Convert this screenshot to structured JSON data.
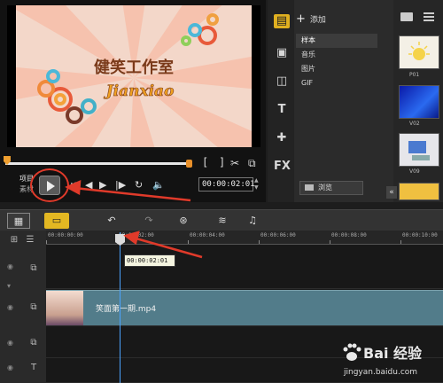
{
  "preview": {
    "banner_cn": "健笑工作室",
    "banner_en": "Jianxiao",
    "mode_project": "项目",
    "mode_clip": "素材",
    "timecode": "00:00:02:01",
    "bracket_in": "[",
    "bracket_out": "]",
    "scissors_icon": "✂",
    "copy_icon": "⧉"
  },
  "transport": {
    "home": "⏮",
    "prev": "◀|",
    "step_back": "◀",
    "step_fwd": "▶",
    "next": "|▶",
    "repeat": "↻",
    "volume": "🔈"
  },
  "media": {
    "add_label": "添加",
    "categories": [
      "样本",
      "音乐",
      "图片",
      "GIF"
    ],
    "browse_label": "浏览",
    "thumbs": [
      "P01",
      "V02",
      "V09"
    ],
    "fx_label": "FX",
    "text_label": "T",
    "collapse": "«"
  },
  "timeline": {
    "ruler_labels": [
      "00:00:00:00",
      "00:00:02:00",
      "00:00:04:00",
      "00:00:06:00",
      "00:00:08:00",
      "00:00:10:00"
    ],
    "playhead_time": "00:00:02:01",
    "clip_name": "笑面第一期.mp4"
  },
  "watermark": {
    "title": "Bai 经验",
    "site": "jingyan.baidu.com"
  },
  "colors": {
    "accent": "#e3b722",
    "annotation_red": "#e03a2a",
    "clip": "#527c8a",
    "playhead": "#4aa3ff"
  }
}
